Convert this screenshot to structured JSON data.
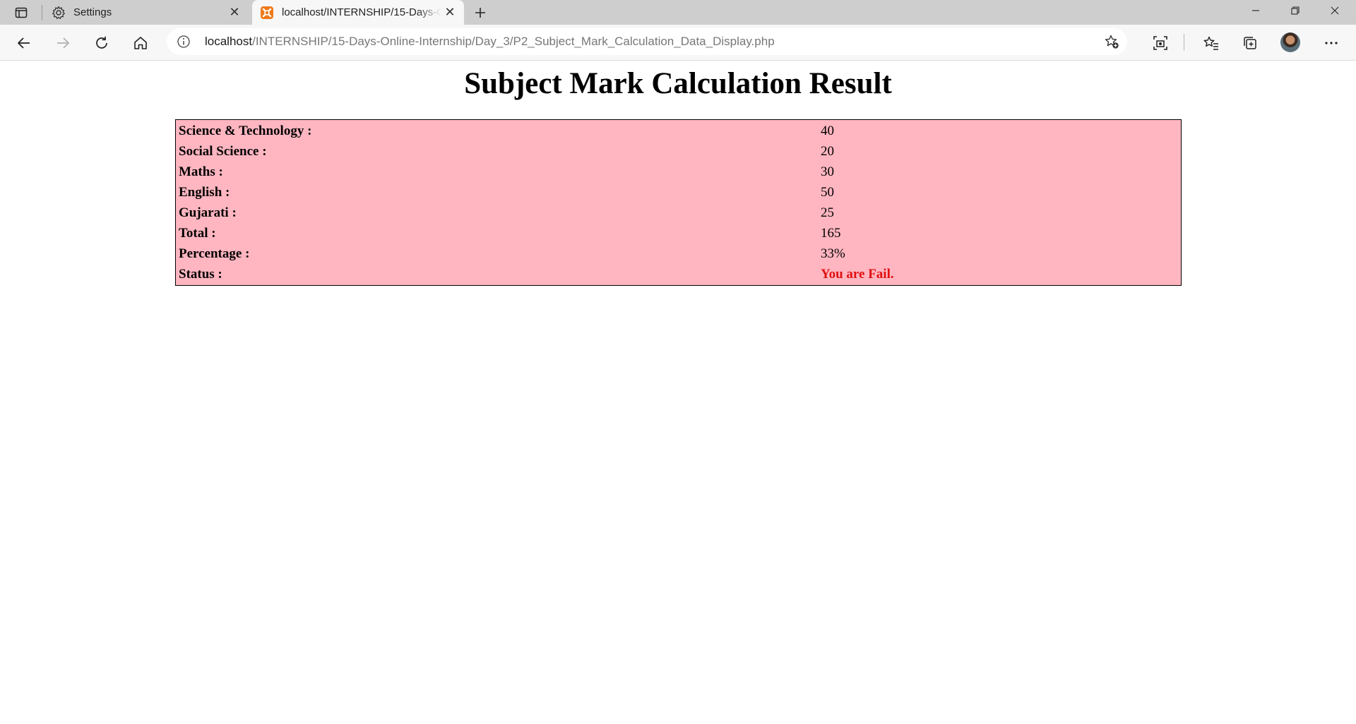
{
  "browser": {
    "tabs": [
      {
        "title": "Settings",
        "icon": "gear-icon",
        "active": false
      },
      {
        "title": "localhost/INTERNSHIP/15-Days-Online-Internship/Day_3/P2_Subject_Mark_Calculation_Data_Display.php",
        "icon": "xampp-icon",
        "active": true
      }
    ],
    "address": {
      "host": "localhost",
      "path": "/INTERNSHIP/15-Days-Online-Internship/Day_3/P2_Subject_Mark_Calculation_Data_Display.php"
    }
  },
  "page": {
    "heading": "Subject Mark Calculation Result",
    "rows": [
      {
        "label": "Science & Technology :",
        "value": "40"
      },
      {
        "label": "Social Science :",
        "value": "20"
      },
      {
        "label": "Maths :",
        "value": "30"
      },
      {
        "label": "English :",
        "value": "50"
      },
      {
        "label": "Gujarati :",
        "value": "25"
      },
      {
        "label": "Total :",
        "value": "165"
      },
      {
        "label": "Percentage :",
        "value": "33%"
      },
      {
        "label": "Status :",
        "value": "You are Fail."
      }
    ],
    "colors": {
      "table_background": "#ffb6c1",
      "fail_text": "#e01010"
    }
  }
}
